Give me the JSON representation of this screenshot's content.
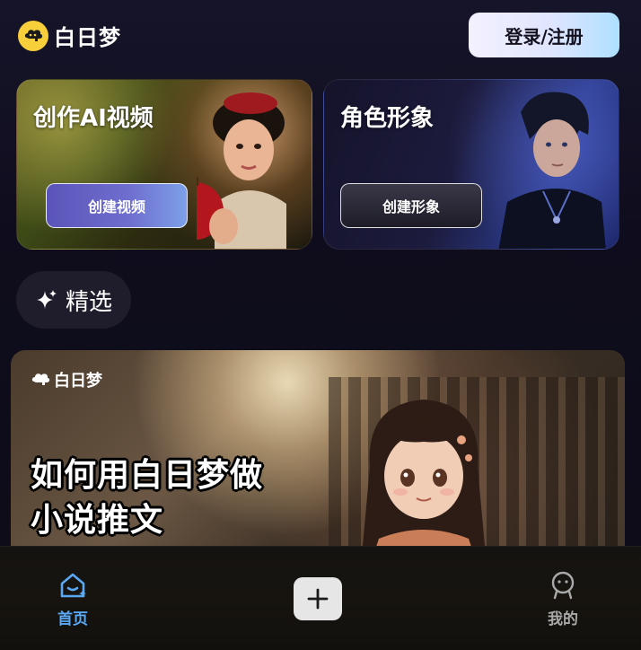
{
  "app": {
    "name": "白日梦",
    "login_label": "登录/注册"
  },
  "cards": [
    {
      "title": "创作AI视频",
      "button_label": "创建视频"
    },
    {
      "title": "角色形象",
      "button_label": "创建形象"
    }
  ],
  "featured": {
    "label": "精选",
    "icon": "sparkle-icon"
  },
  "banner": {
    "logo_text": "白日梦",
    "line1": "如何用白日梦做",
    "line2": "小说推文"
  },
  "nav": {
    "home_label": "首页",
    "me_label": "我的",
    "home_icon": "home-icon",
    "add_icon": "plus-icon",
    "me_icon": "profile-icon"
  },
  "colors": {
    "accent": "#5aa8f4",
    "logo_yellow": "#f6cf3a",
    "background": "#0f0d1d"
  }
}
